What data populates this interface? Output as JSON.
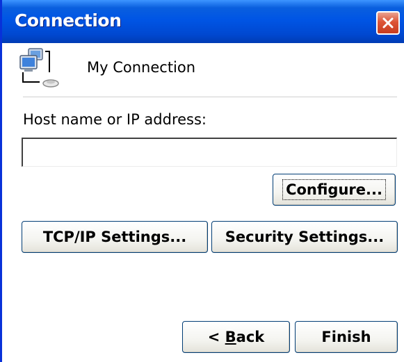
{
  "window": {
    "title": "Connection",
    "close_label": "×",
    "colors": {
      "titlebar": "#0055e5",
      "close_button": "#dd5436",
      "button_border": "#003c74"
    }
  },
  "connection": {
    "icon": "network-computer-icon",
    "name": "My Connection"
  },
  "host": {
    "label": "Host name or IP address:",
    "value": "",
    "placeholder": ""
  },
  "buttons": {
    "configure": "Configure...",
    "tcpip": "TCP/IP Settings...",
    "security": "Security Settings...",
    "back_prefix": "< ",
    "back_mnemonic": "B",
    "back_rest": "ack",
    "finish": "Finish"
  }
}
